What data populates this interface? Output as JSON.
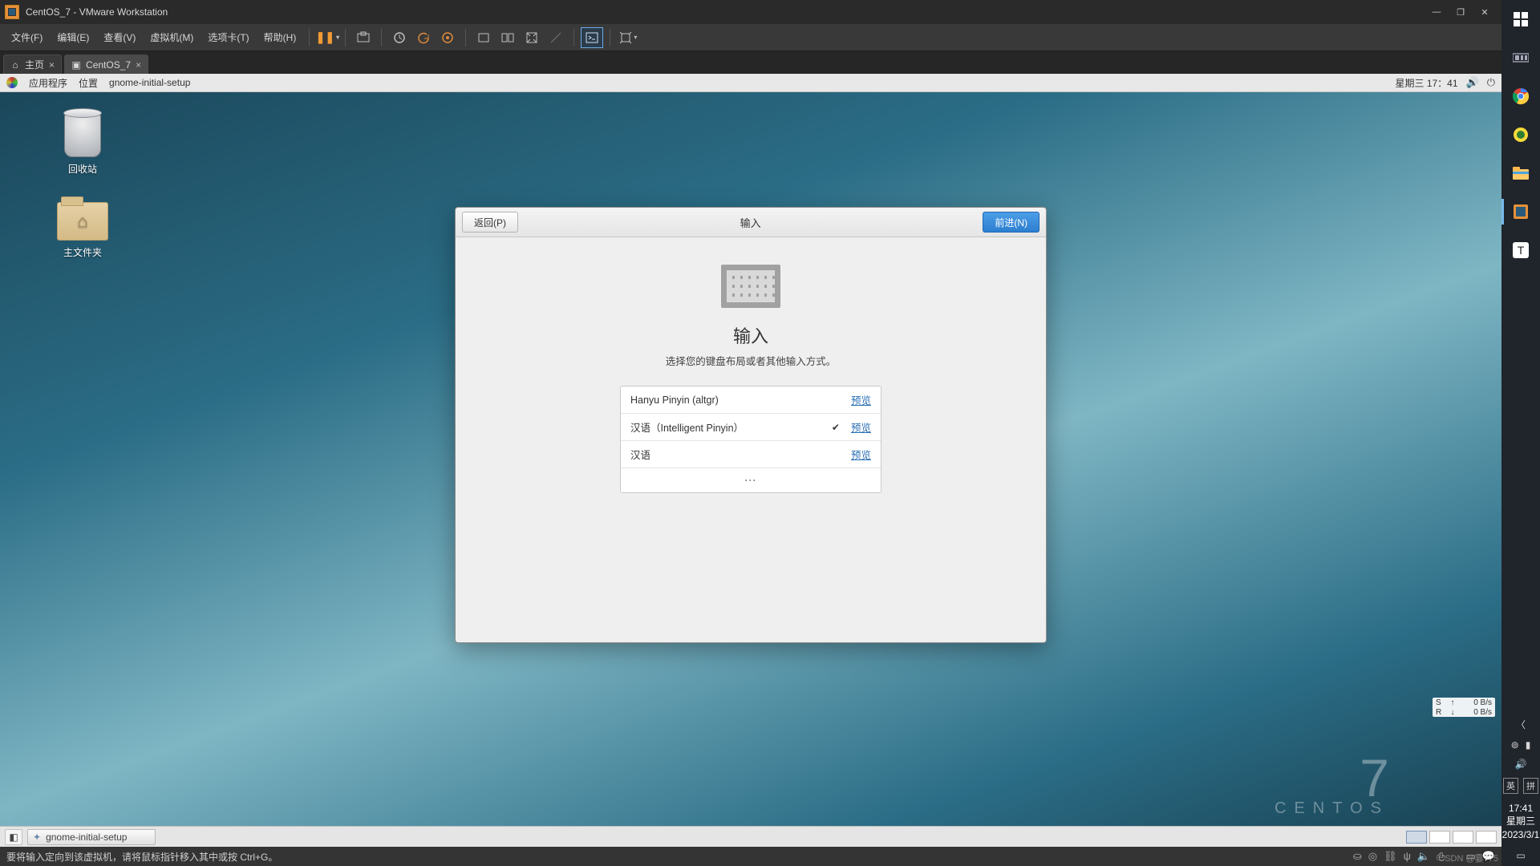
{
  "vmware": {
    "title": "CentOS_7 - VMware Workstation",
    "menu": {
      "file": "文件(F)",
      "edit": "编辑(E)",
      "view": "查看(V)",
      "vm": "虚拟机(M)",
      "tabs": "选项卡(T)",
      "help": "帮助(H)"
    },
    "tabs": {
      "home": "主页",
      "vm": "CentOS_7"
    },
    "hint": "要将输入定向到该虚拟机，请将鼠标指针移入其中或按 Ctrl+G。"
  },
  "gnome": {
    "top": {
      "applications": "应用程序",
      "places": "位置",
      "app_title": "gnome-initial-setup",
      "datetime": "星期三 17：41"
    },
    "desktop": {
      "trash": "回收站",
      "home_folder": "主文件夹"
    },
    "bottom_task": "gnome-initial-setup"
  },
  "setup": {
    "back": "返回(P)",
    "next": "前进(N)",
    "header_title": "输入",
    "heading": "输入",
    "subtitle": "选择您的键盘布局或者其他输入方式。",
    "preview": "预览",
    "items": [
      {
        "name": "Hanyu Pinyin (altgr)",
        "selected": false
      },
      {
        "name": "汉语（Intelligent Pinyin）",
        "selected": true
      },
      {
        "name": "汉语",
        "selected": false
      }
    ]
  },
  "centos_brand": {
    "digit": "7",
    "name": "CENTOS"
  },
  "netspeed": {
    "s_label": "S",
    "r_label": "R",
    "s_val": "0 B/s",
    "r_val": "0 B/s"
  },
  "win": {
    "ime1": "英",
    "ime2": "拼",
    "time": "17:41",
    "weekday": "星期三",
    "date": "2023/3/1"
  },
  "watermark": "CSDN @霎775"
}
